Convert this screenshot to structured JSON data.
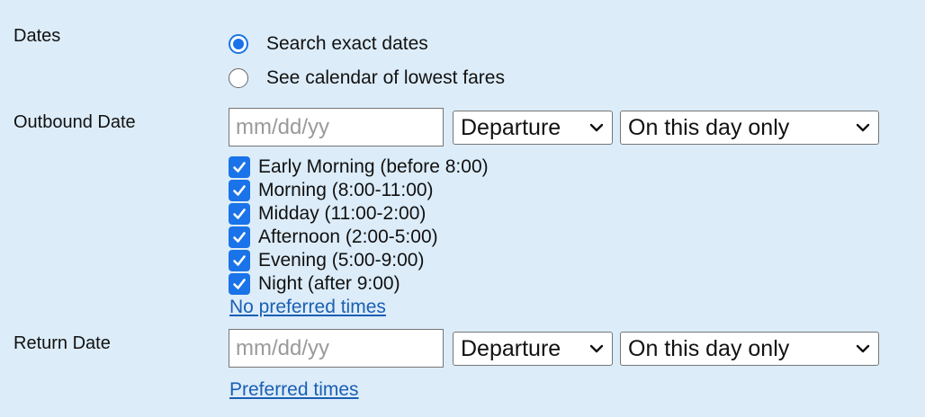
{
  "dates": {
    "label": "Dates",
    "options": [
      {
        "label": "Search exact dates",
        "checked": true
      },
      {
        "label": "See calendar of lowest fares",
        "checked": false
      }
    ]
  },
  "outbound": {
    "label": "Outbound Date",
    "date_placeholder": "mm/dd/yy",
    "type_select": "Departure",
    "range_select": "On this day only",
    "times": [
      {
        "label": "Early Morning (before 8:00)",
        "checked": true
      },
      {
        "label": "Morning (8:00-11:00)",
        "checked": true
      },
      {
        "label": "Midday (11:00-2:00)",
        "checked": true
      },
      {
        "label": "Afternoon (2:00-5:00)",
        "checked": true
      },
      {
        "label": "Evening (5:00-9:00)",
        "checked": true
      },
      {
        "label": "Night (after 9:00)",
        "checked": true
      }
    ],
    "times_link": "No preferred times"
  },
  "return": {
    "label": "Return Date",
    "date_placeholder": "mm/dd/yy",
    "type_select": "Departure",
    "range_select": "On this day only",
    "times_link": "Preferred times"
  },
  "colors": {
    "background": "#dcecf9",
    "accent": "#1a73e8",
    "link": "#1a5fb4"
  }
}
